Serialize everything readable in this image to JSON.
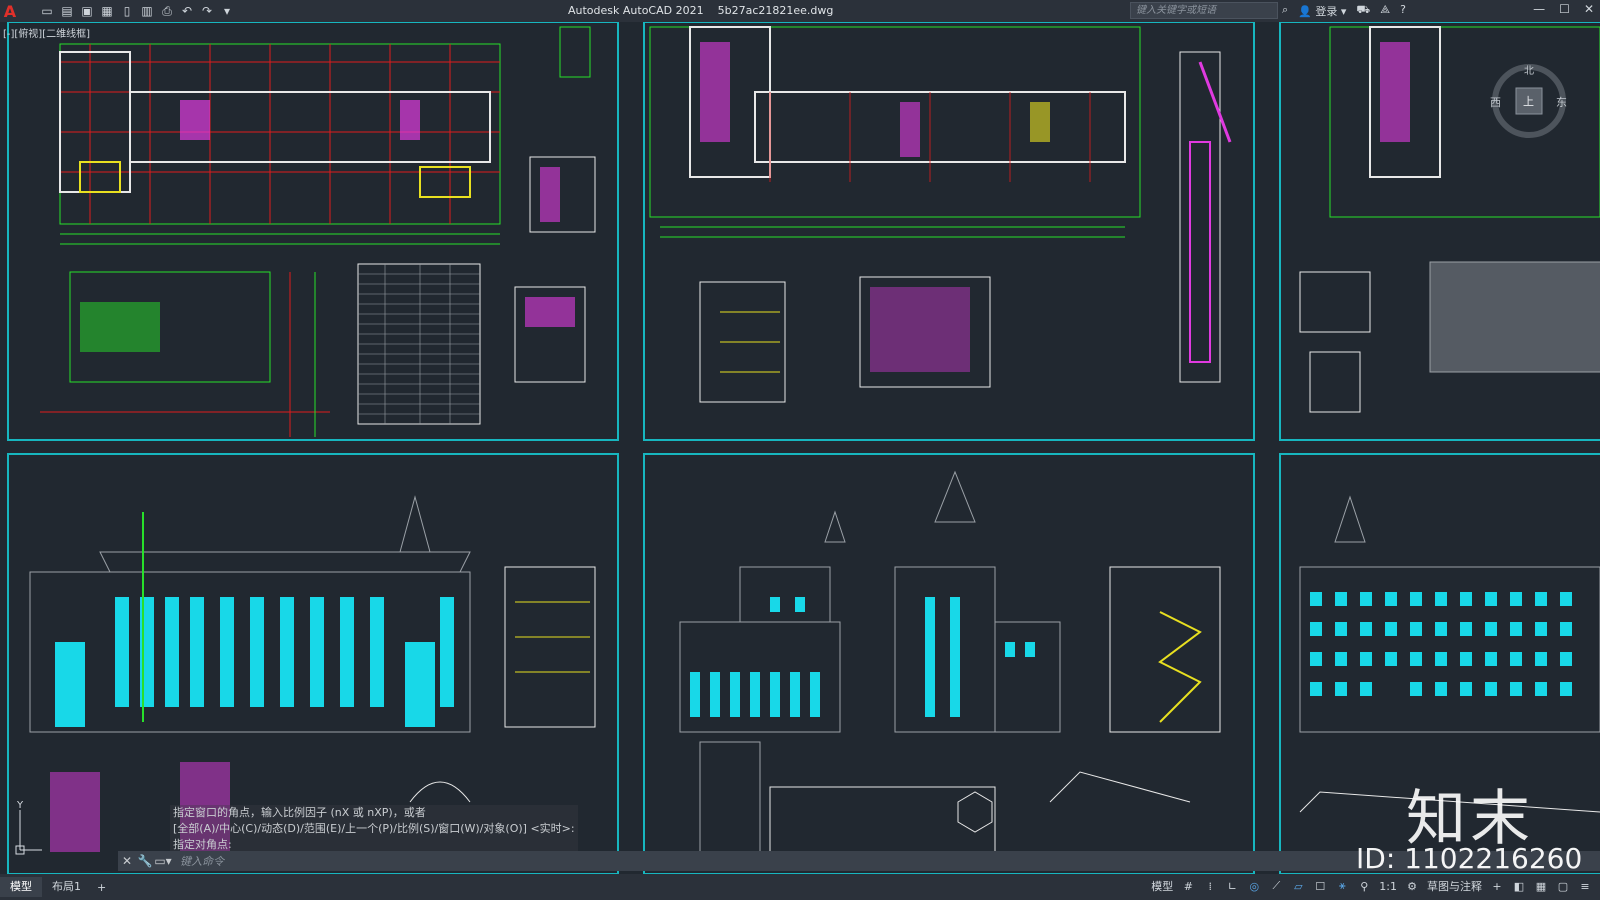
{
  "app": {
    "logo": "A",
    "title": "Autodesk AutoCAD 2021",
    "filename": "5b27ac21821ee.dwg",
    "search_placeholder": "键入关键字或短语",
    "login": "登录"
  },
  "quick_access": [
    "new-icon",
    "open-icon",
    "save-icon",
    "saveas-icon",
    "plot-preview-icon",
    "publish-icon",
    "print-icon",
    "undo-icon",
    "redo-icon",
    "dropdown-icon"
  ],
  "viewport": {
    "label": "[-][俯视][二维线框]"
  },
  "navcube": {
    "north": "北",
    "west": "西",
    "east": "东",
    "top": "上"
  },
  "command": {
    "history": [
      "指定窗口的角点，输入比例因子 (nX 或 nXP)，或者",
      "[全部(A)/中心(C)/动态(D)/范围(E)/上一个(P)/比例(S)/窗口(W)/对象(O)] <实时>:",
      "指定对角点:"
    ],
    "placeholder": "键入命令"
  },
  "tabs": {
    "model": "模型",
    "layout1": "布局1",
    "add": "+"
  },
  "status": {
    "mode": "模型",
    "scale": "1:1",
    "workspace": "草图与注释"
  },
  "watermark": {
    "brand": "知末",
    "id": "ID: 1102216260"
  },
  "colors": {
    "background": "#212830",
    "sheet_border": "#17b6bf",
    "green": "#28e02a",
    "red": "#e01c1c",
    "magenta": "#e03ae0",
    "cyan": "#18d8e8",
    "yellow": "#e8e020"
  }
}
